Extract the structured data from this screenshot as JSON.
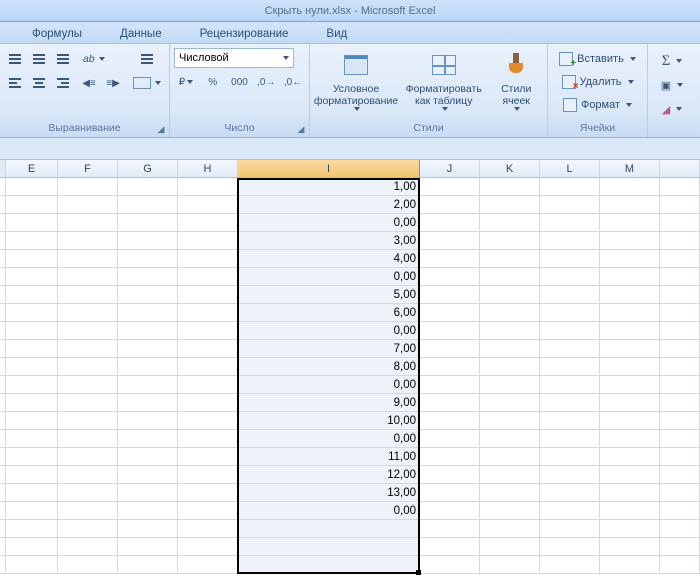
{
  "title": "Скрыть нули.xlsx - Microsoft Excel",
  "tabs": {
    "formulas": "Формулы",
    "data": "Данные",
    "review": "Рецензирование",
    "view": "Вид"
  },
  "ribbon": {
    "alignment": {
      "label": "Выравнивание",
      "wrap": "",
      "merge": ""
    },
    "number": {
      "label": "Число",
      "format": "Числовой",
      "pct": "%",
      "thou": "000",
      "inc": ",00",
      "dec": ",00"
    },
    "styles": {
      "label": "Стили",
      "cond": "Условное\nформатирование",
      "table": "Форматировать\nкак таблицу",
      "cell": "Стили\nячеек"
    },
    "cells": {
      "label": "Ячейки",
      "insert": "Вставить",
      "delete": "Удалить",
      "format": "Формат"
    }
  },
  "columns": [
    "E",
    "F",
    "G",
    "H",
    "I",
    "J",
    "K",
    "L",
    "M"
  ],
  "selected_column": "I",
  "values": [
    "1,00",
    "2,00",
    "0,00",
    "3,00",
    "4,00",
    "0,00",
    "5,00",
    "6,00",
    "0,00",
    "7,00",
    "8,00",
    "0,00",
    "9,00",
    "10,00",
    "0,00",
    "11,00",
    "12,00",
    "13,00",
    "0,00"
  ],
  "chart_data": {
    "type": "table",
    "columns": [
      "I"
    ],
    "rows": [
      [
        1.0
      ],
      [
        2.0
      ],
      [
        0.0
      ],
      [
        3.0
      ],
      [
        4.0
      ],
      [
        0.0
      ],
      [
        5.0
      ],
      [
        6.0
      ],
      [
        0.0
      ],
      [
        7.0
      ],
      [
        8.0
      ],
      [
        0.0
      ],
      [
        9.0
      ],
      [
        10.0
      ],
      [
        0.0
      ],
      [
        11.0
      ],
      [
        12.0
      ],
      [
        13.0
      ],
      [
        0.0
      ]
    ]
  }
}
